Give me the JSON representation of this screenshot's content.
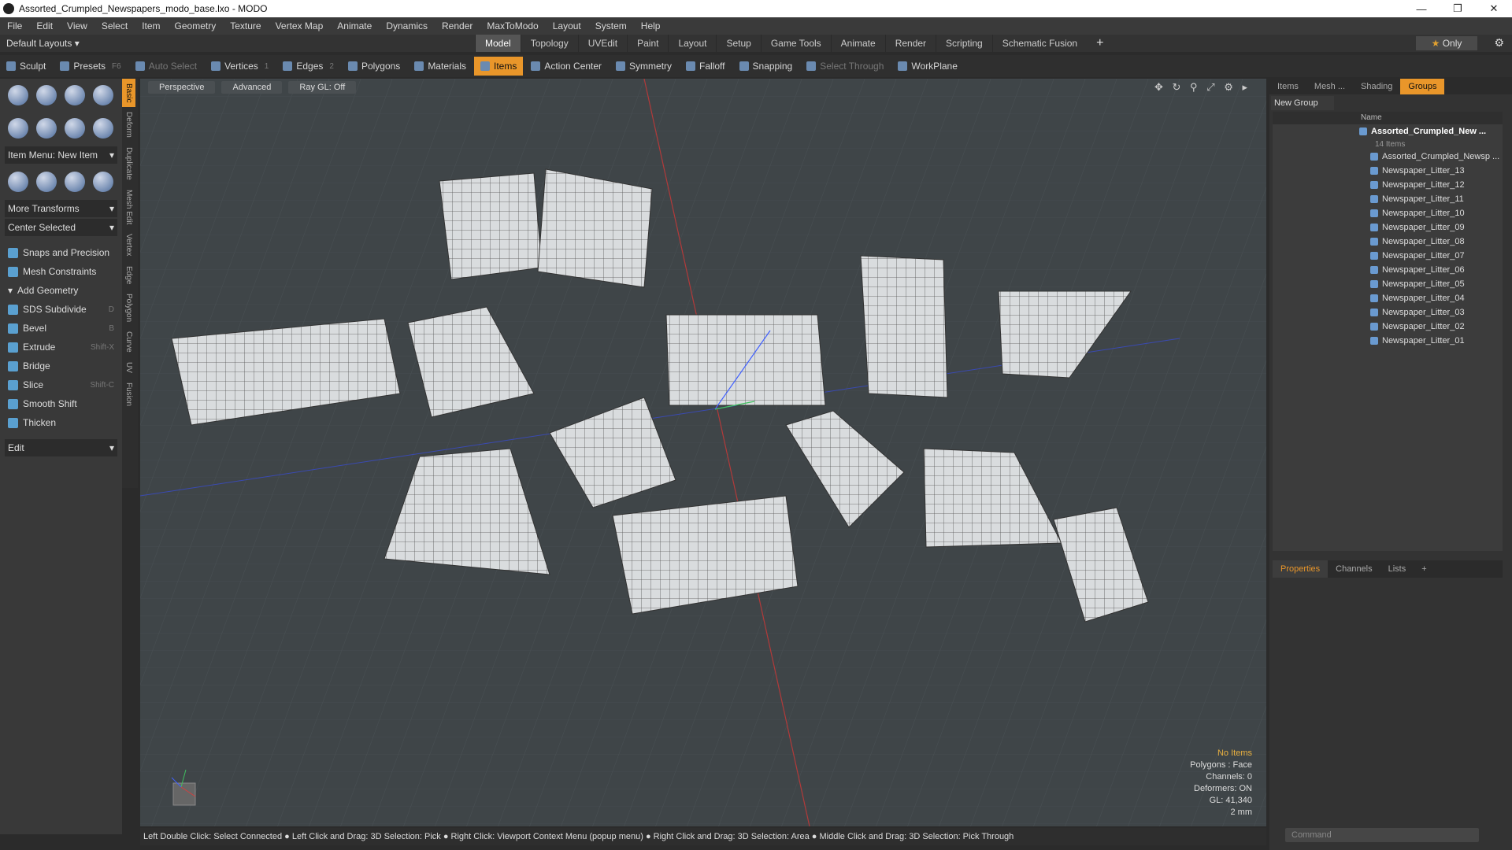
{
  "window": {
    "title": "Assorted_Crumpled_Newspapers_modo_base.lxo - MODO",
    "min": "—",
    "max": "❐",
    "close": "✕"
  },
  "menu": [
    "File",
    "Edit",
    "View",
    "Select",
    "Item",
    "Geometry",
    "Texture",
    "Vertex Map",
    "Animate",
    "Dynamics",
    "Render",
    "MaxToModo",
    "Layout",
    "System",
    "Help"
  ],
  "layout": {
    "preset": "Default Layouts ▾",
    "tabs": [
      "Model",
      "Topology",
      "UVEdit",
      "Paint",
      "Layout",
      "Setup",
      "Game Tools",
      "Animate",
      "Render",
      "Scripting",
      "Schematic Fusion"
    ],
    "active": "Model",
    "plus": "+",
    "only": "Only"
  },
  "toolbar": {
    "sculpt": "Sculpt",
    "presets": "Presets",
    "presets_sc": "F6",
    "auto_select": "Auto Select",
    "vertices": "Vertices",
    "vertices_n": "1",
    "edges": "Edges",
    "edges_n": "2",
    "polygons": "Polygons",
    "materials": "Materials",
    "items": "Items",
    "action_center": "Action Center",
    "symmetry": "Symmetry",
    "falloff": "Falloff",
    "snapping": "Snapping",
    "select_through": "Select Through",
    "workplane": "WorkPlane"
  },
  "left": {
    "item_menu": "Item Menu: New Item",
    "more_transforms": "More Transforms",
    "center_selected": "Center Selected",
    "snaps": "Snaps and Precision",
    "constraints": "Mesh Constraints",
    "add_geometry": "Add Geometry",
    "tools": [
      {
        "label": "SDS Subdivide",
        "sc": "D"
      },
      {
        "label": "Bevel",
        "sc": "B"
      },
      {
        "label": "Extrude",
        "sc": "Shift-X"
      },
      {
        "label": "Bridge",
        "sc": ""
      },
      {
        "label": "Slice",
        "sc": "Shift-C"
      },
      {
        "label": "Smooth Shift",
        "sc": ""
      },
      {
        "label": "Thicken",
        "sc": ""
      }
    ],
    "edit": "Edit",
    "vtabs": [
      "Basic",
      "Deform",
      "Duplicate",
      "Mesh Edit",
      "Vertex",
      "Edge",
      "Polygon",
      "Curve",
      "UV",
      "Fusion"
    ]
  },
  "viewport": {
    "perspective": "Perspective",
    "advanced": "Advanced",
    "raygl": "Ray GL: Off",
    "icons": "✥ ↻ ⚲ ⤢ ⚙ ▸",
    "info": {
      "items": "No Items",
      "polygons": "Polygons : Face",
      "channels": "Channels: 0",
      "deformers": "Deformers: ON",
      "gl": "GL: 41,340",
      "scale": "2 mm"
    }
  },
  "status": "Left Double Click: Select Connected ● Left Click and Drag: 3D Selection: Pick ● Right Click: Viewport Context Menu (popup menu) ● Right Click and Drag: 3D Selection: Area ● Middle Click and Drag: 3D Selection: Pick Through",
  "right": {
    "tabs": [
      "Items",
      "Mesh ...",
      "Shading",
      "Groups"
    ],
    "active_tab": "Groups",
    "new_group": "New Group",
    "col_name": "Name",
    "group": "Assorted_Crumpled_New ...",
    "count": "14 Items",
    "items": [
      "Assorted_Crumpled_Newsp ...",
      "Newspaper_Litter_13",
      "Newspaper_Litter_12",
      "Newspaper_Litter_11",
      "Newspaper_Litter_10",
      "Newspaper_Litter_09",
      "Newspaper_Litter_08",
      "Newspaper_Litter_07",
      "Newspaper_Litter_06",
      "Newspaper_Litter_05",
      "Newspaper_Litter_04",
      "Newspaper_Litter_03",
      "Newspaper_Litter_02",
      "Newspaper_Litter_01"
    ],
    "prop_tabs": [
      "Properties",
      "Channels",
      "Lists",
      "+"
    ],
    "command": "Command"
  }
}
